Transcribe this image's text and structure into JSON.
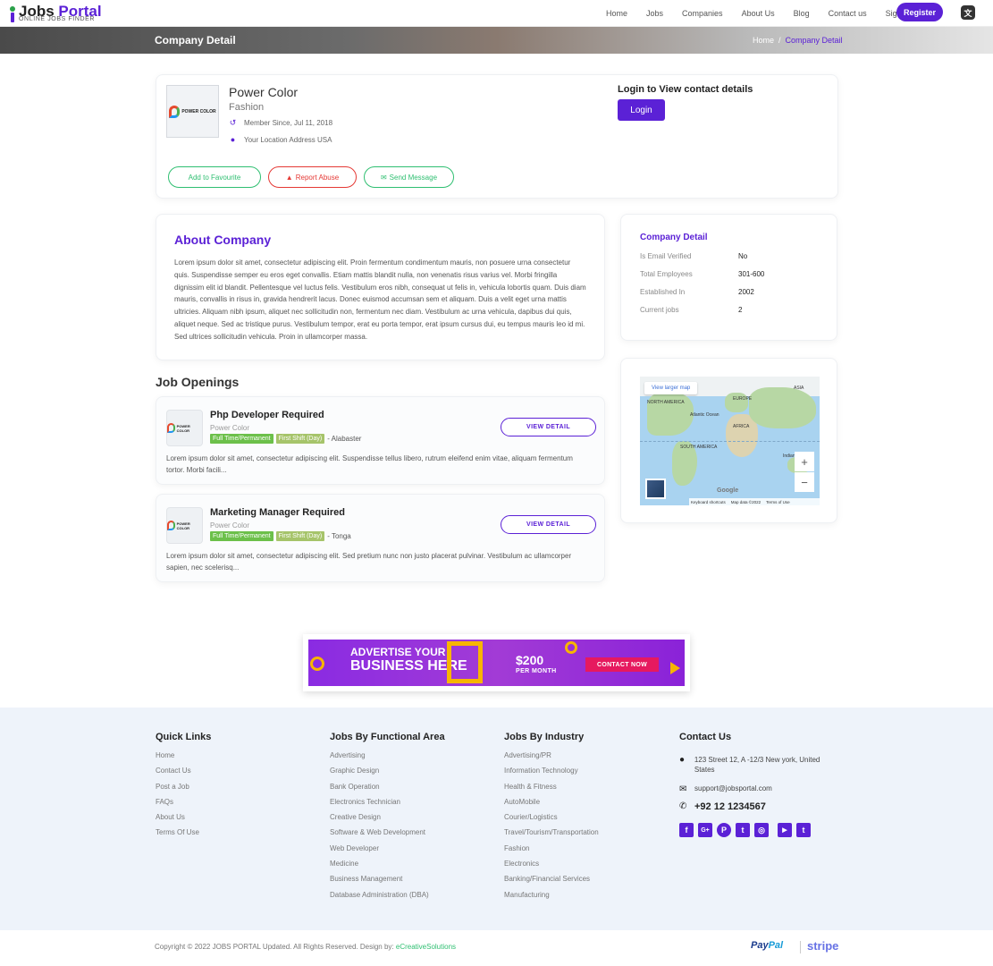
{
  "header": {
    "logo_title_main": "Jobs",
    "logo_title_accent": "Portal",
    "logo_subtitle": "ONLINE JOBS FINDER",
    "nav": [
      "Home",
      "Jobs",
      "Companies",
      "About Us",
      "Blog",
      "Contact us",
      "Sign in"
    ],
    "register_label": "Register",
    "lang_icon": "translate-icon",
    "lang_glyph": "文"
  },
  "banner": {
    "title": "Company Detail",
    "breadcrumb_home": "Home",
    "breadcrumb_sep": "/",
    "breadcrumb_current": "Company Detail"
  },
  "company": {
    "logo_text": "POWER COLOR",
    "name": "Power Color",
    "industry": "Fashion",
    "member_since": "Member Since, Jul 11, 2018",
    "location": "Your Location Address USA",
    "login_title": "Login to View contact details",
    "login_label": "Login",
    "fav_label": "Add to Favourite",
    "abuse_label": "Report Abuse",
    "message_label": "Send Message"
  },
  "about": {
    "heading": "About Company",
    "text": "Lorem ipsum dolor sit amet, consectetur adipiscing elit. Proin fermentum condimentum mauris, non posuere urna consectetur quis. Suspendisse semper eu eros eget convallis. Etiam mattis blandit nulla, non venenatis risus varius vel. Morbi fringilla dignissim elit id blandit. Pellentesque vel luctus felis. Vestibulum eros nibh, consequat ut felis in, vehicula lobortis quam. Duis diam mauris, convallis in risus in, gravida hendrerit lacus. Donec euismod accumsan sem et aliquam. Duis a velit eget urna mattis ultricies. Aliquam nibh ipsum, aliquet nec sollicitudin non, fermentum nec diam. Vestibulum ac urna vehicula, dapibus dui quis, aliquet neque. Sed ac tristique purus. Vestibulum tempor, erat eu porta tempor, erat ipsum cursus dui, eu tempus mauris leo id mi. Sed ultrices sollicitudin vehicula. Proin in ullamcorper massa."
  },
  "details": {
    "heading": "Company Detail",
    "rows": [
      {
        "label": "Is Email Verified",
        "value": "No"
      },
      {
        "label": "Total Employees",
        "value": "301-600"
      },
      {
        "label": "Established In",
        "value": "2002"
      },
      {
        "label": "Current jobs",
        "value": "2"
      }
    ]
  },
  "map": {
    "larger_label": "View larger map",
    "labels": [
      "NORTH AMERICA",
      "EUROPE",
      "ASIA",
      "AFRICA",
      "SOUTH AMERICA",
      "Atlantic Ocean",
      "Indian Ocean"
    ],
    "zoom_in": "+",
    "zoom_out": "−",
    "google": "Google",
    "attr": [
      "Keyboard shortcuts",
      "Map data ©2022",
      "Terms of Use"
    ]
  },
  "openings": {
    "heading": "Job Openings",
    "jobs": [
      {
        "title": "Php Developer Required",
        "company": "Power Color",
        "tag1": "Full Time/Permanent",
        "tag2": "First Shift (Day)",
        "location": "- Alabaster",
        "desc": "Lorem ipsum dolor sit amet, consectetur adipiscing elit. Suspendisse tellus libero, rutrum eleifend enim vitae, aliquam fermentum tortor. Morbi facili...",
        "btn": "VIEW DETAIL"
      },
      {
        "title": "Marketing Manager Required",
        "company": "Power Color",
        "tag1": "Full Time/Permanent",
        "tag2": "First Shift (Day)",
        "location": "- Tonga",
        "desc": "Lorem ipsum dolor sit amet, consectetur adipiscing elit. Sed pretium nunc non justo placerat pulvinar. Vestibulum ac ullamcorper sapien, nec scelerisq...",
        "btn": "VIEW DETAIL"
      }
    ]
  },
  "ad": {
    "line1": "ADVERTISE YOUR",
    "line2": "BUSINESS HERE",
    "price": "$200",
    "per": "PER MONTH",
    "cta": "CONTACT NOW"
  },
  "footer": {
    "quick": {
      "heading": "Quick Links",
      "items": [
        "Home",
        "Contact Us",
        "Post a Job",
        "FAQs",
        "About Us",
        "Terms Of Use"
      ]
    },
    "functional": {
      "heading": "Jobs By Functional Area",
      "items": [
        "Advertising",
        "Graphic Design",
        "Bank Operation",
        "Electronics Technician",
        "Creative Design",
        "Software & Web Development",
        "Web Developer",
        "Medicine",
        "Business Management",
        "Database Administration (DBA)"
      ]
    },
    "industry": {
      "heading": "Jobs By Industry",
      "items": [
        "Advertising/PR",
        "Information Technology",
        "Health & Fitness",
        "AutoMobile",
        "Courier/Logistics",
        "Travel/Tourism/Transportation",
        "Fashion",
        "Electronics",
        "Banking/Financial Services",
        "Manufacturing"
      ]
    },
    "contact": {
      "heading": "Contact Us",
      "address": "123 Street 12, A -12/3 New york, United States",
      "email": "support@jobsportal.com",
      "phone": "+92 12 1234567"
    },
    "socials": [
      {
        "icon": "facebook-icon",
        "glyph": "f"
      },
      {
        "icon": "google-plus-icon",
        "glyph": "G+"
      },
      {
        "icon": "pinterest-icon",
        "glyph": "P"
      },
      {
        "icon": "twitter-icon",
        "glyph": "t"
      },
      {
        "icon": "instagram-icon",
        "glyph": "◎"
      },
      {
        "icon": "youtube-icon",
        "glyph": "▶"
      },
      {
        "icon": "tumblr-icon",
        "glyph": "t"
      }
    ],
    "copyright": "Copyright © 2022 JOBS PORTAL Updated. All Rights Reserved. Design by: ",
    "designer": "eCreativeSolutions",
    "paypal_a": "Pay",
    "paypal_b": "Pal",
    "stripe": "stripe"
  },
  "colors": {
    "accent": "#5b21d6",
    "success": "#2fbf71",
    "danger": "#e53935",
    "footer_bg": "#eef3fa"
  }
}
